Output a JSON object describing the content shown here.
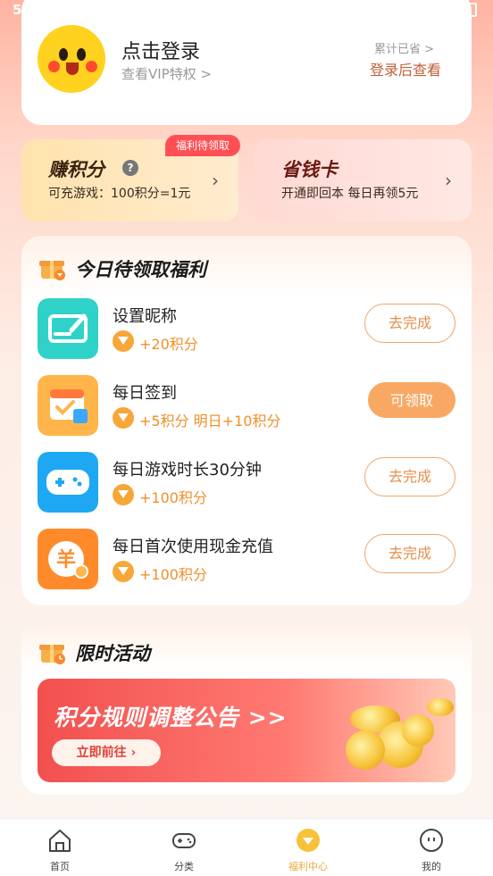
{
  "status_bar": {
    "left_text": "5"
  },
  "login": {
    "title": "点击登录",
    "subtitle": "查看VIP特权 >",
    "saved_label": "累计已省 >",
    "saved_value": "登录后查看"
  },
  "earn_points": {
    "title": "赚积分",
    "help_icon": "?",
    "tag": "福利待领取",
    "desc": "可充游戏：100积分=1元",
    "chevron": "›"
  },
  "save_card": {
    "title": "省钱卡",
    "desc": "开通即回本 每日再领5元",
    "chevron": "›"
  },
  "tasks": {
    "title": "今日待领取福利",
    "items": [
      {
        "icon": "edit-icon",
        "name": "设置昵称",
        "reward": "+20积分",
        "button": "去完成"
      },
      {
        "icon": "calendar-icon",
        "name": "每日签到",
        "reward": "+5积分 明日+10积分",
        "button": "可领取"
      },
      {
        "icon": "gamepad-icon",
        "name": "每日游戏时长30分钟",
        "reward": "+100积分",
        "button": "去完成"
      },
      {
        "icon": "yuan-coin-icon",
        "name": "每日首次使用现金充值",
        "reward": "+100积分",
        "button": "去完成"
      }
    ]
  },
  "activity": {
    "title": "限时活动",
    "banner_title": "积分规则调整公告 >>",
    "banner_button": "立即前往 ›"
  },
  "nav": {
    "items": [
      {
        "icon": "home-icon",
        "label": "首页"
      },
      {
        "icon": "gamepad-icon",
        "label": "分类"
      },
      {
        "icon": "welfare-icon",
        "label": "福利中心"
      },
      {
        "icon": "profile-icon",
        "label": "我的"
      }
    ]
  },
  "colors": {
    "accent": "#f9a864",
    "tag_red": "#ff4f55",
    "nav_active": "#f2a33a"
  }
}
